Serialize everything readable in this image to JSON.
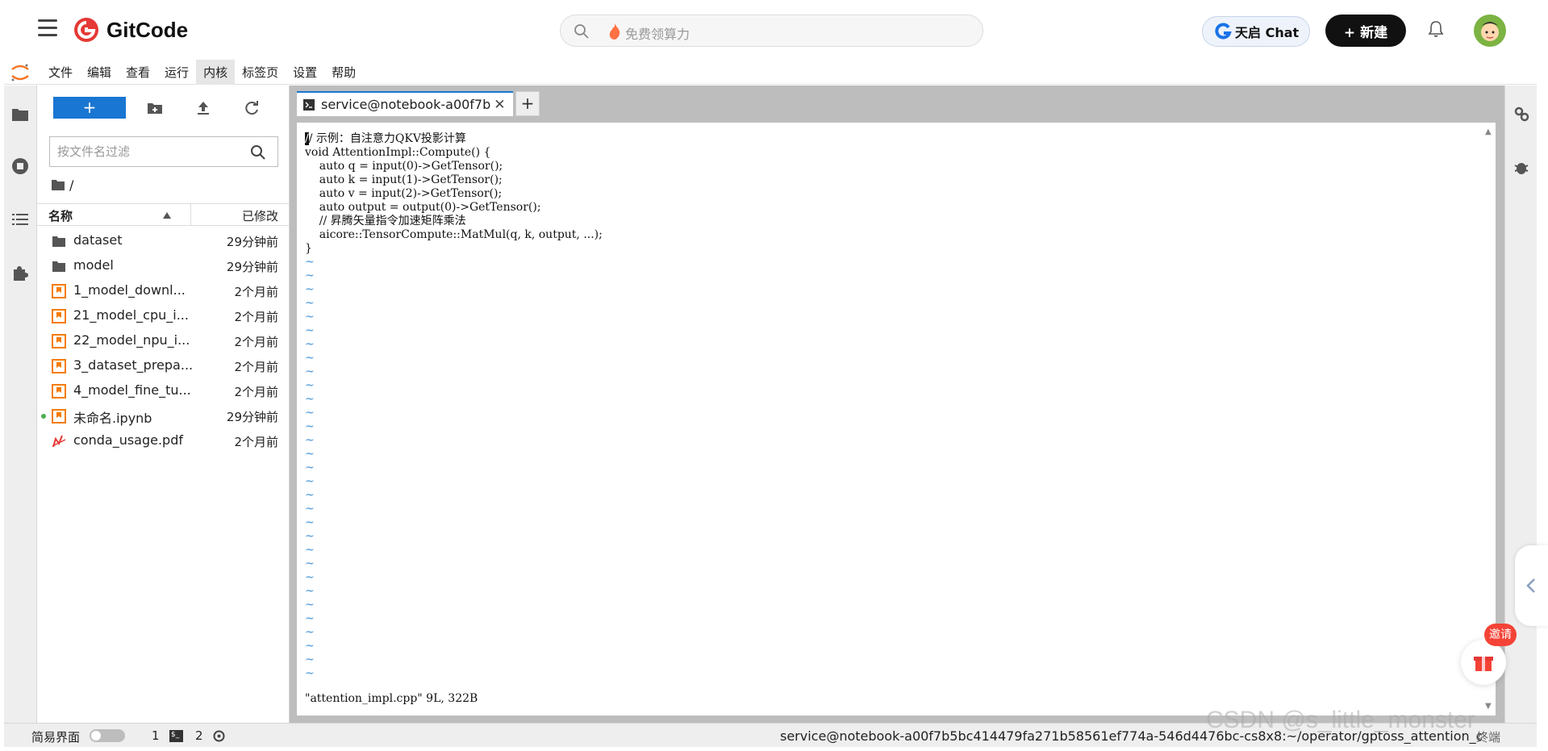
{
  "header": {
    "brand": "GitCode",
    "search_placeholder": "免费领算力",
    "chat_label": "天启 Chat",
    "new_label": "+ 新建"
  },
  "menubar": {
    "items": [
      "文件",
      "编辑",
      "查看",
      "运行",
      "内核",
      "标签页",
      "设置",
      "帮助"
    ],
    "active": "内核"
  },
  "filebrowser": {
    "new_label": "+",
    "filter_placeholder": "按文件名过滤",
    "breadcrumb": "/",
    "col_name": "名称",
    "col_modified": "已修改",
    "files": [
      {
        "name": "dataset",
        "modified": "29分钟前",
        "type": "folder"
      },
      {
        "name": "model",
        "modified": "29分钟前",
        "type": "folder"
      },
      {
        "name": "1_model_downl...",
        "modified": "2个月前",
        "type": "notebook"
      },
      {
        "name": "21_model_cpu_i...",
        "modified": "2个月前",
        "type": "notebook"
      },
      {
        "name": "22_model_npu_i...",
        "modified": "2个月前",
        "type": "notebook"
      },
      {
        "name": "3_dataset_prepa...",
        "modified": "2个月前",
        "type": "notebook"
      },
      {
        "name": "4_model_fine_tu...",
        "modified": "2个月前",
        "type": "notebook"
      },
      {
        "name": "未命名.ipynb",
        "modified": "29分钟前",
        "type": "notebook",
        "running": true
      },
      {
        "name": "conda_usage.pdf",
        "modified": "2个月前",
        "type": "pdf"
      }
    ]
  },
  "terminal": {
    "tab_label": "service@notebook-a00f7b",
    "tab_close": "✕",
    "tab_add": "+",
    "cursor_char": "/",
    "code_first_rest": "/ 示例：自注意力QKV投影计算",
    "code_lines": [
      "void AttentionImpl::Compute() {",
      "    auto q = input(0)->GetTensor();",
      "    auto k = input(1)->GetTensor();",
      "    auto v = input(2)->GetTensor();",
      "    auto output = output(0)->GetTensor();",
      "    // 昇腾矢量指令加速矩阵乘法",
      "    aicore::TensorCompute::MatMul(q, k, output, ...);",
      "}"
    ],
    "tilde_count": 31,
    "tilde_char": "~",
    "status_line": "\"attention_impl.cpp\" 9L, 322B"
  },
  "statusbar": {
    "simple_mode": "简易界面",
    "count1": "1",
    "count2": "2",
    "path": "service@notebook-a00f7b5bc414479fa271b58561ef774a-546d4476bc-cs8x8:~/operator/gptoss_attention_op",
    "mode_text": "终端"
  },
  "overlay": {
    "invite": "邀请",
    "watermark": "CSDN @s_little_monster"
  },
  "colors": {
    "accent": "#1976d2",
    "brand_red": "#e53935",
    "tilde_blue": "#3b8ed8",
    "notebook_orange": "#f57c00"
  }
}
